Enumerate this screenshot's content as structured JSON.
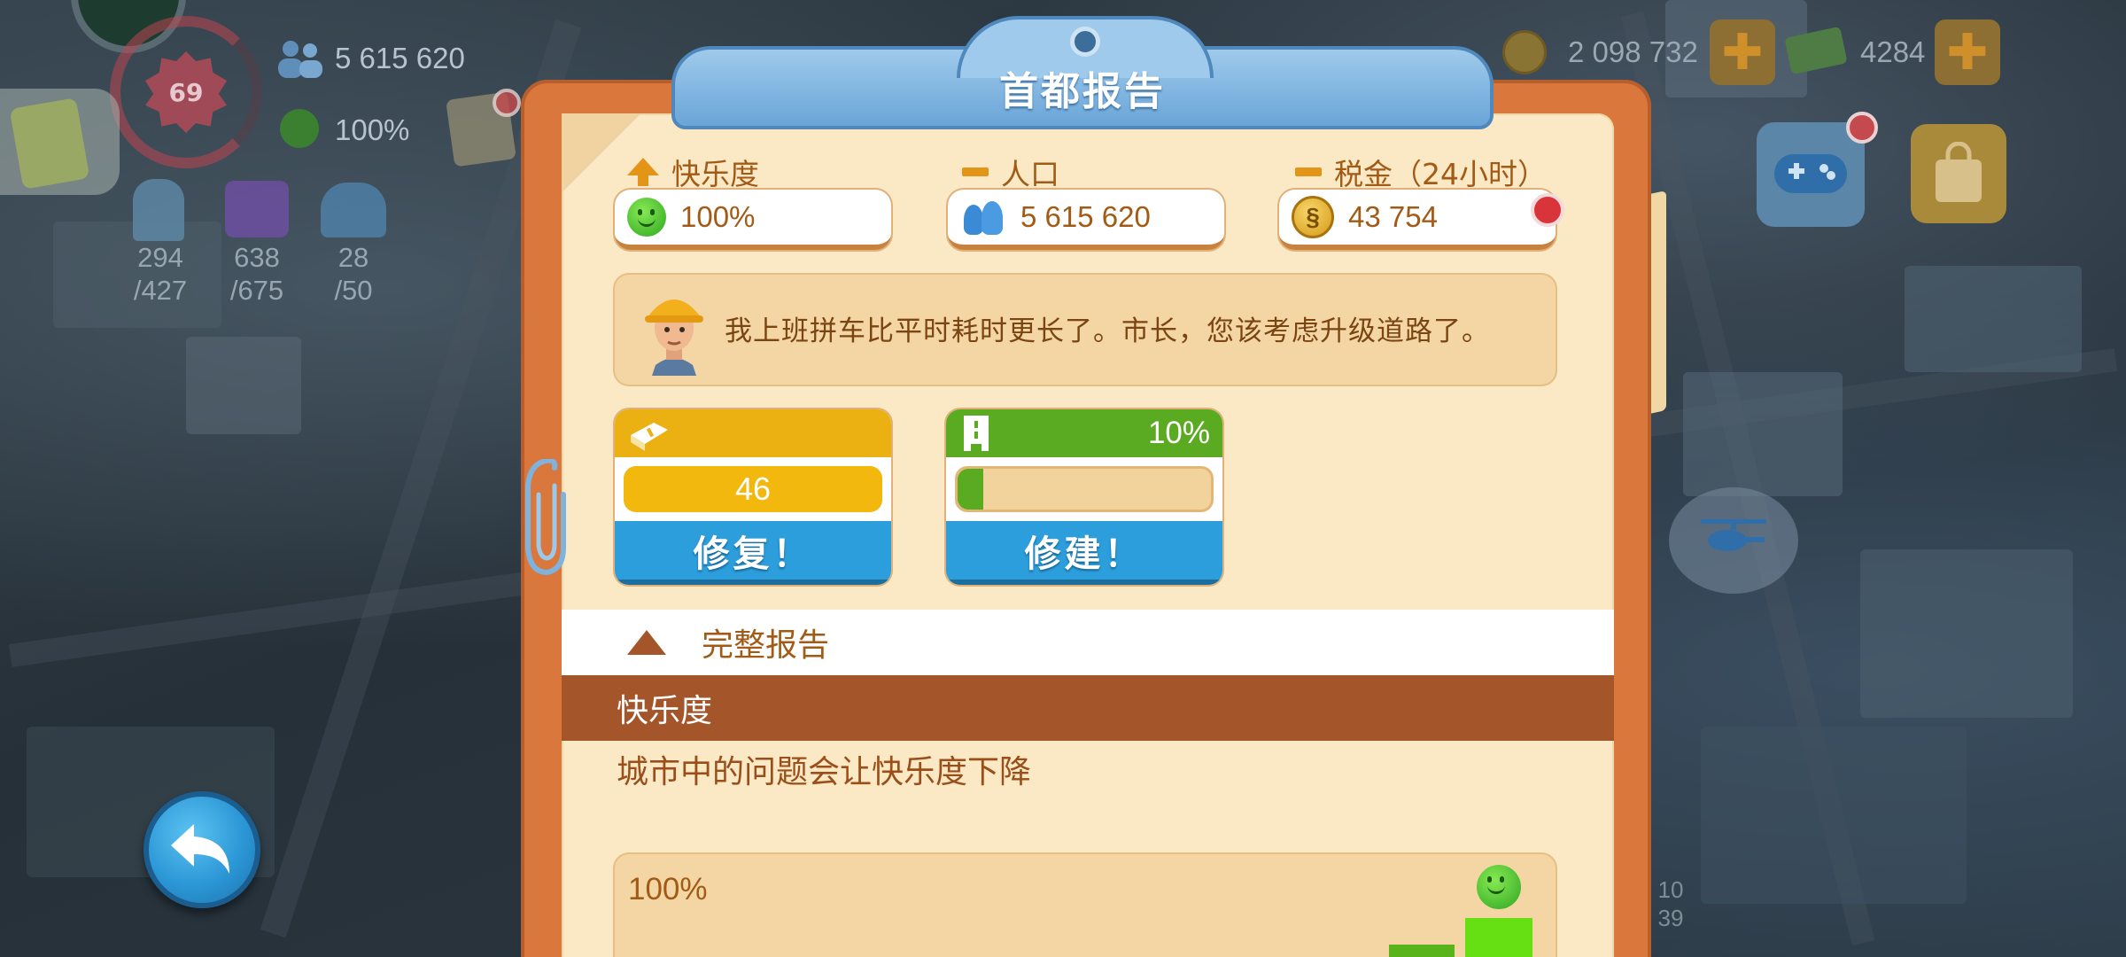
{
  "hud": {
    "level": "69",
    "population": "5 615 620",
    "happiness": "100%",
    "water_current": "294",
    "water_max": "/427",
    "sewage_current": "638",
    "sewage_max": "/675",
    "fire_current": "28",
    "fire_max": "/50",
    "simoleons": "2 098 732",
    "simcash": "4284",
    "add_symbol": "✚",
    "partial_top_1": "10",
    "partial_top_2": "39"
  },
  "panel": {
    "title": "首都报告",
    "stats": {
      "happiness_label": "快乐度",
      "happiness_value": "100%",
      "population_label": "人口",
      "population_value": "5 615 620",
      "tax_label": "税金（24小时）",
      "tax_value": "43 754"
    },
    "message": "我上班拼车比平时耗时更长了。市长，您该考虑升级道路了。",
    "repair_card": {
      "value": "46",
      "progress": 1.0,
      "button_label": "修复！"
    },
    "build_card": {
      "percent": "10%",
      "progress": 0.1,
      "button_label": "修建！"
    },
    "report": {
      "toggle_label": "完整报告",
      "section_title": "快乐度",
      "section_desc": "城市中的问题会让快乐度下降",
      "chart_top_label": "100%"
    }
  },
  "colors": {
    "panel_orange": "#d9773c",
    "panel_cream": "#fbe9c6",
    "title_blue": "#6aa5d8",
    "accent_gold": "#e39518",
    "button_blue": "#2c9edc",
    "section_brown": "#a4552a",
    "happy_green": "#5fd61c"
  },
  "icons": {
    "happiness": "smiley-face-icon",
    "population": "people-icon",
    "tax": "simoleon-coin-icon",
    "repair": "repair-book-icon",
    "build": "road-build-icon",
    "back": "back-arrow-icon"
  }
}
